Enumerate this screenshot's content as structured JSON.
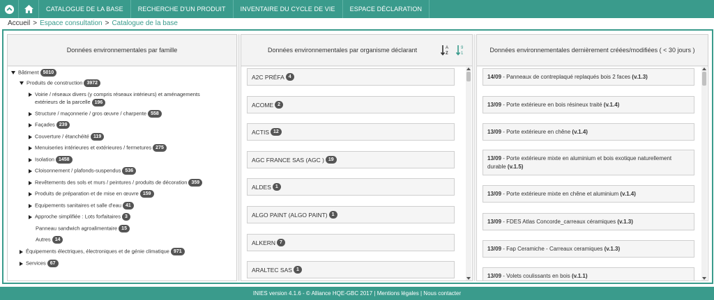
{
  "nav": {
    "items": [
      "CATALOGUE DE LA BASE",
      "RECHERCHE D'UN PRODUIT",
      "INVENTAIRE DU CYCLE DE VIE",
      "ESPACE DÉCLARATION"
    ]
  },
  "breadcrumb": {
    "home": "Accueil",
    "sep": ">",
    "level1": "Espace consultation",
    "level2": "Catalogue de la base"
  },
  "left_panel": {
    "title": "Données environnementales par famille",
    "tree": {
      "root": {
        "label": "Bâtiment",
        "count": "5010"
      },
      "group": {
        "label": "Produits de construction",
        "count": "3972"
      },
      "items": [
        {
          "label": "Voirie / réseaux divers (y compris réseaux intérieurs) et aménagements",
          "label2": "extérieurs de la parcelle",
          "count": "196"
        },
        {
          "label": "Structure / maçonnerie / gros œuvre / charpente",
          "count": "558"
        },
        {
          "label": "Façades",
          "count": "239"
        },
        {
          "label": "Couverture / étanchéité",
          "count": "119"
        },
        {
          "label": "Menuiseries intérieures et extérieures / fermetures",
          "count": "275"
        },
        {
          "label": "Isolation",
          "count": "1458"
        },
        {
          "label": "Cloisonnement / plafonds-suspendus",
          "count": "536"
        },
        {
          "label": "Revêtements des sols et murs / peintures / produits de décoration",
          "count": "359"
        },
        {
          "label": "Produits de préparation et de mise en œuvre",
          "count": "159"
        },
        {
          "label": "Equipements sanitaires et salle d'eau",
          "count": "41"
        },
        {
          "label": "Approche simplifiée : Lots forfaitaires",
          "count": "3"
        }
      ],
      "leaves": [
        {
          "label": "Panneau sandwich agroalimentaire",
          "count": "15"
        },
        {
          "label": "Autres",
          "count": "14"
        }
      ],
      "others": [
        {
          "label": "Équipements électriques, électroniques et de génie climatique",
          "count": "971"
        },
        {
          "label": "Services",
          "count": "67"
        }
      ]
    }
  },
  "middle_panel": {
    "title": "Données environnementales par organisme déclarant",
    "sort_az_icon": "sort-alpha-icon",
    "sort_num_icon": "sort-numeric-icon",
    "orgs": [
      {
        "name": "A2C PRÉFA",
        "count": "4"
      },
      {
        "name": "ACOME",
        "count": "2"
      },
      {
        "name": "ACTIS",
        "count": "12"
      },
      {
        "name": "AGC FRANCE SAS (AGC )",
        "count": "19"
      },
      {
        "name": "ALDES",
        "count": "1"
      },
      {
        "name": "ALGO PAINT (ALGO PAINT)",
        "count": "1"
      },
      {
        "name": "ALKERN",
        "count": "7"
      },
      {
        "name": "ARALTEC SAS",
        "count": "1"
      }
    ]
  },
  "right_panel": {
    "title": "Données environnementales dernièrement créées/modifiées ( < 30 jours )",
    "entries": [
      {
        "date": "14/09",
        "text": " - Panneaux de contreplaqué replaqués bois 2 faces ",
        "version": "(v.1.3)"
      },
      {
        "date": "13/09",
        "text": " - Porte extérieure en bois résineux traité ",
        "version": "(v.1.4)"
      },
      {
        "date": "13/09",
        "text": " - Porte extérieure en chêne ",
        "version": "(v.1.4)"
      },
      {
        "date": "13/09",
        "text": " - Porte extérieure mixte en aluminium et bois exotique naturellement durable ",
        "version": "(v.1.5)"
      },
      {
        "date": "13/09",
        "text": " - Porte extérieure mixte en chêne et aluminium ",
        "version": "(v.1.4)"
      },
      {
        "date": "13/09",
        "text": " - FDES Atlas Concorde_carreaux céramiques ",
        "version": "(v.1.3)"
      },
      {
        "date": "13/09",
        "text": " - Fap Ceramiche - Carreaux ceramiques ",
        "version": "(v.1.3)"
      },
      {
        "date": "13/09",
        "text": " - Volets coulissants en bois ",
        "version": "(v.1.1)"
      }
    ]
  },
  "footer": {
    "version": "INIES version 4.1.6 - © Alliance HQE-GBC 2017",
    "sep": " | ",
    "legal": "Mentions légales",
    "contact": "Nous contacter"
  },
  "colors": {
    "accent": "#3a9b8c",
    "badge": "#555555"
  }
}
